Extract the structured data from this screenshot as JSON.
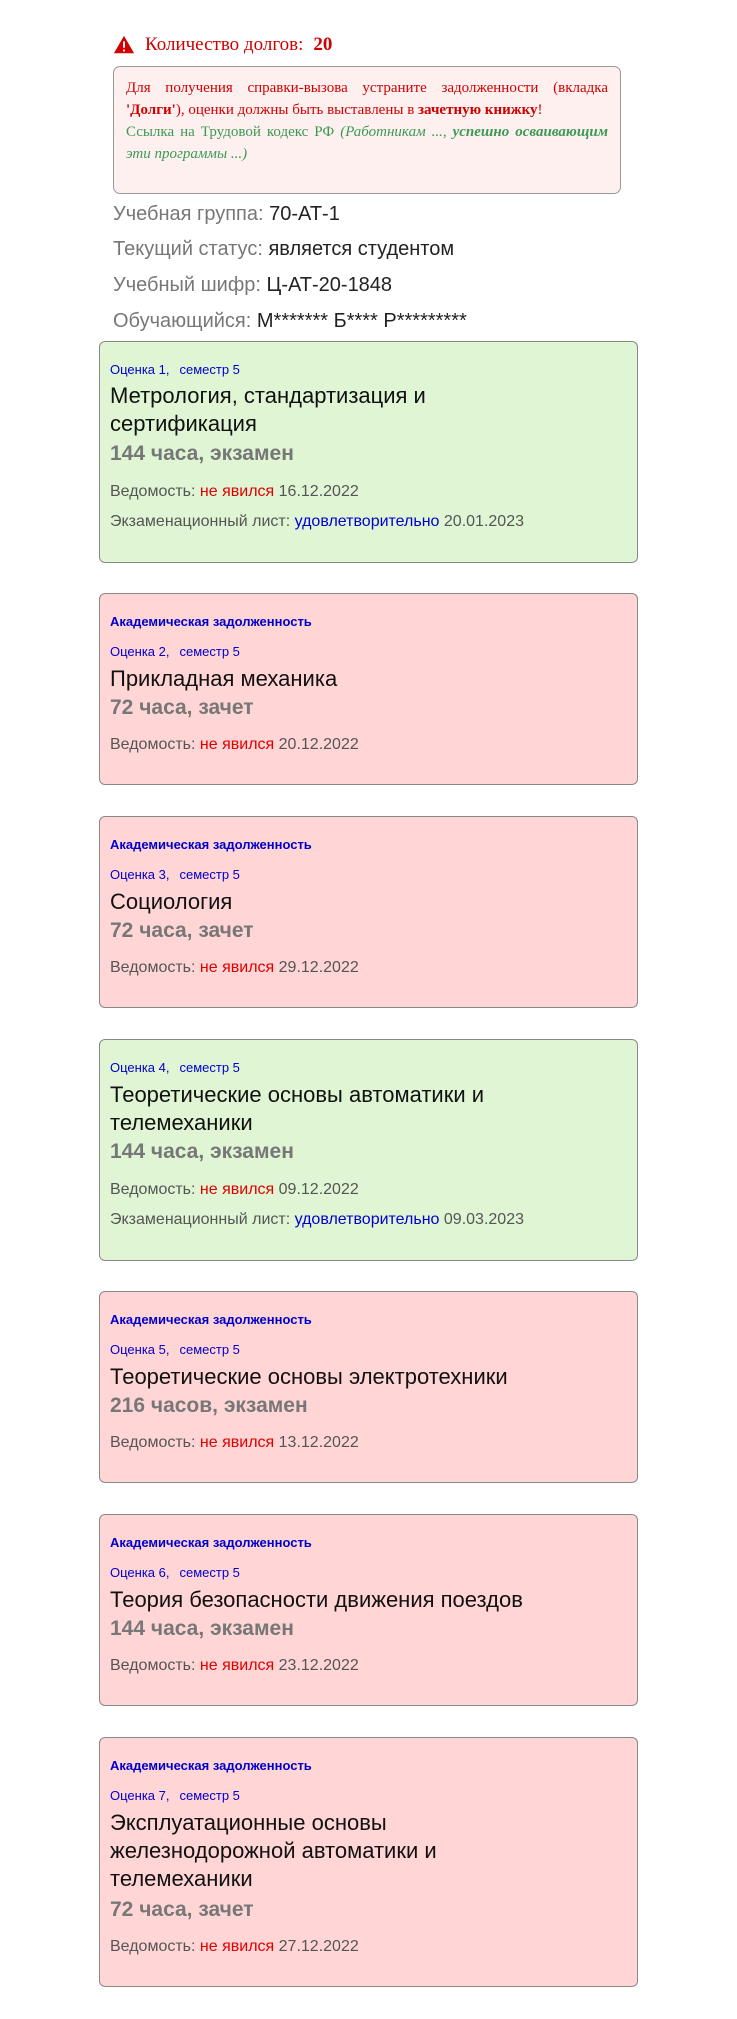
{
  "header": {
    "debt_label": "Количество долгов:",
    "debt_count": "20"
  },
  "notice": {
    "p1_a": "Для получения справки-вызова устраните задолженности (вкладка ",
    "p1_tab": "'Долги'",
    "p1_b": "), оценки должны быть выставлены в ",
    "p1_book": "зачетную книжку",
    "p1_end": "!",
    "p2_a": "Ссылка на Трудовой кодекс РФ ",
    "p2_b": "(Работникам ..., ",
    "p2_c": "успешно осваивающим",
    "p2_d": " эти программы ...)"
  },
  "student": {
    "group_label": "Учебная группа:",
    "group_value": "70-АТ-1",
    "status_label": "Текущий статус:",
    "status_value": "является студентом",
    "cipher_label": "Учебный шифр:",
    "cipher_value": "Ц-АТ-20-1848",
    "name_label": "Обучающийся:",
    "name_value": "М******* Б**** Р*********"
  },
  "labels": {
    "academic_debt": "Академическая задолженность",
    "vedomost": "Ведомость:",
    "no_show": "не явился",
    "exam_sheet": "Экзаменационный лист:",
    "satisfactory": "удовлетворительно"
  },
  "cards": [
    {
      "grade": "Оценка 1,",
      "semester": "семестр 5",
      "title_l1": "Метрология, стандартизация и",
      "title_l2": "сертификация",
      "title_l3": "",
      "hours": "144 часа, экзамен",
      "ved_date": "16.12.2022",
      "exam_date": "20.01.2023"
    },
    {
      "grade": "Оценка 2,",
      "semester": "семестр 5",
      "title_l1": "Прикладная механика",
      "title_l2": "",
      "title_l3": "",
      "hours": "72 часа, зачет",
      "ved_date": "20.12.2022",
      "exam_date": ""
    },
    {
      "grade": "Оценка 3,",
      "semester": "семестр 5",
      "title_l1": "Социология",
      "title_l2": "",
      "title_l3": "",
      "hours": "72 часа, зачет",
      "ved_date": "29.12.2022",
      "exam_date": ""
    },
    {
      "grade": "Оценка 4,",
      "semester": "семестр 5",
      "title_l1": "Теоретические основы автоматики и",
      "title_l2": "телемеханики",
      "title_l3": "",
      "hours": "144 часа, экзамен",
      "ved_date": "09.12.2022",
      "exam_date": "09.03.2023"
    },
    {
      "grade": "Оценка 5,",
      "semester": "семестр 5",
      "title_l1": "Теоретические основы электротехники",
      "title_l2": "",
      "title_l3": "",
      "hours": "216 часов, экзамен",
      "ved_date": "13.12.2022",
      "exam_date": ""
    },
    {
      "grade": "Оценка 6,",
      "semester": "семестр 5",
      "title_l1": "Теория безопасности движения поездов",
      "title_l2": "",
      "title_l3": "",
      "hours": "144 часа, экзамен",
      "ved_date": "23.12.2022",
      "exam_date": ""
    },
    {
      "grade": "Оценка 7,",
      "semester": "семестр 5",
      "title_l1": "Эксплуатационные основы",
      "title_l2": "железнодорожной автоматики и",
      "title_l3": "телемеханики",
      "hours": "72 часа, зачет",
      "ved_date": "27.12.2022",
      "exam_date": ""
    }
  ],
  "colors": {
    "passed_bg": "#dff5d4",
    "debt_bg": "#ffd5d5",
    "alert_red": "#d00000",
    "link_blue": "#0000cc"
  }
}
